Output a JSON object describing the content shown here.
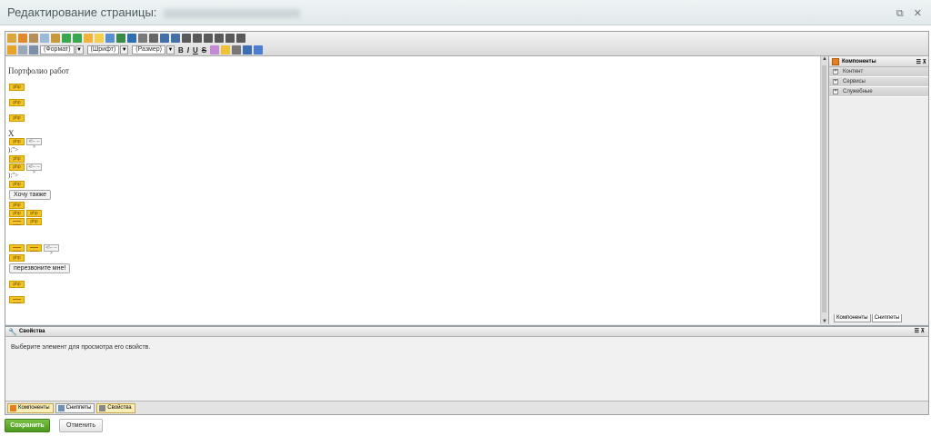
{
  "titlebar": {
    "title": "Редактирование страницы:",
    "window_icons": [
      "restore-icon",
      "close-icon"
    ]
  },
  "toolbar": {
    "format_select": "(Формат)",
    "font_select": "(Шрифт)",
    "size_select": "(Размер)",
    "bold": "B",
    "italic": "I",
    "underline": "U",
    "strike": "S"
  },
  "content": {
    "heading": "Портфолио работ",
    "x_text": "X",
    "frag1": ");\">",
    "frag2": ");\">",
    "php_label": "php",
    "comment_label": "<!-- -->",
    "btn_want": "Хочу также",
    "btn_call": "перезвоните мне!"
  },
  "components": {
    "title": "Компоненты",
    "items": [
      "Контент",
      "Сервисы",
      "Служебные"
    ],
    "tabs": [
      "Компоненты",
      "Сниппеты"
    ]
  },
  "properties": {
    "title": "Свойства",
    "message": "Выберите элемент для просмотра его свойств."
  },
  "bottom_tabs": [
    "Компоненты",
    "Сниппеты",
    "Свойства"
  ],
  "actions": {
    "save": "Сохранить",
    "cancel": "Отменить"
  },
  "colors": {
    "save_button": "#5aab2a",
    "php_tag": "#f4c425",
    "titlebar": "#e6edef"
  }
}
